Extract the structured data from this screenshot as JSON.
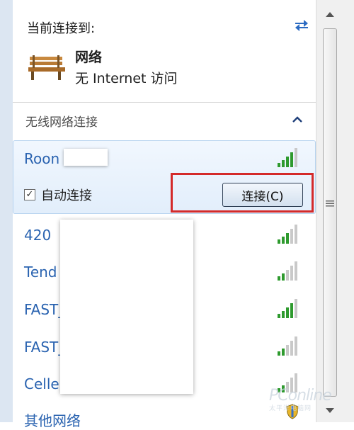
{
  "header": {
    "title": "当前连接到:"
  },
  "current": {
    "name": "网络",
    "status": "无 Internet 访问"
  },
  "section": {
    "title": "无线网络连接"
  },
  "networks": [
    {
      "label": "Roon"
    },
    {
      "label": "420"
    },
    {
      "label": "Tend"
    },
    {
      "label": "FAST_"
    },
    {
      "label": "FAST_"
    },
    {
      "label": "Celle"
    },
    {
      "label": "其他网络"
    }
  ],
  "auto_connect": {
    "label": "自动连接",
    "checked": true
  },
  "connect_button": {
    "label": "连接(C)"
  },
  "watermark": {
    "text": "PConline",
    "sub": "太平洋电脑网"
  },
  "colors": {
    "accent": "#2a63b0",
    "highlight": "#d42a2a",
    "signal": "#2e9a2e"
  },
  "icons": [
    "refresh-icon",
    "bench-icon",
    "collapse-icon",
    "signal-icon",
    "checkbox-icon",
    "scroll-up-icon",
    "scroll-down-icon",
    "shield-icon"
  ]
}
